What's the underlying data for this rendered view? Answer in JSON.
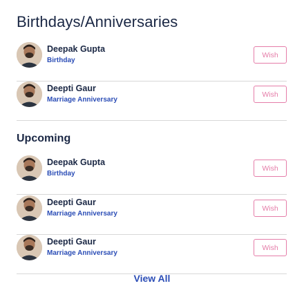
{
  "widget": {
    "title": "Birthdays/Anniversaries",
    "upcoming_title": "Upcoming",
    "view_all_label": "View All",
    "wish_label": "Wish",
    "accent_color": "#e57ca8",
    "link_color": "#2b4db6",
    "heading_color": "#1a2744"
  },
  "today": [
    {
      "name": "Deepak Gupta",
      "occasion": "Birthday",
      "avatar_icon": "person-avatar"
    },
    {
      "name": "Deepti Gaur",
      "occasion": "Marriage Anniversary",
      "avatar_icon": "person-avatar"
    }
  ],
  "upcoming": [
    {
      "name": "Deepak Gupta",
      "occasion": "Birthday",
      "avatar_icon": "person-avatar"
    },
    {
      "name": "Deepti Gaur",
      "occasion": "Marriage Anniversary",
      "avatar_icon": "person-avatar"
    },
    {
      "name": "Deepti Gaur",
      "occasion": "Marriage Anniversary",
      "avatar_icon": "person-avatar"
    }
  ]
}
